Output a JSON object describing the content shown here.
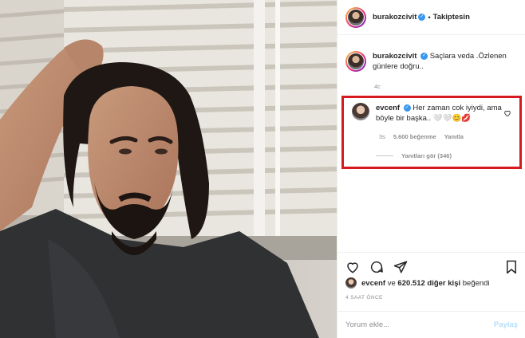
{
  "post": {
    "author": "burakozcivit",
    "follow_state": "Takiptesin",
    "separator": "•",
    "caption": "Saçlara veda .Özlenen günlere doğru..",
    "caption_time": "4c"
  },
  "highlighted_comment": {
    "author": "evcenf",
    "text": "Her zaman cok iyiydi, ama böyle bir başka..",
    "emoji": "🤍🤍😊💋",
    "time": "3s",
    "likes": "5.600 beğenme",
    "reply_label": "Yanıtla",
    "view_replies": "Yanıtları gör (346)",
    "highlight_color": "#d71920"
  },
  "liked_by": {
    "user": "evcenf",
    "middle": " ve ",
    "others": "620.512 diğer kişi",
    "suffix": " beğendi"
  },
  "post_time": "4 SAAT ÖNCE",
  "comment_input": {
    "placeholder": "Yorum ekle...",
    "post_label": "Paylaş"
  },
  "icons": {
    "like": "heart-icon",
    "comment": "comment-icon",
    "share": "share-icon",
    "save": "bookmark-icon",
    "verified": "verified-badge-icon"
  },
  "colors": {
    "verified": "#3897f0",
    "post_button": "#b2dffc",
    "muted": "#8e8e8e"
  }
}
